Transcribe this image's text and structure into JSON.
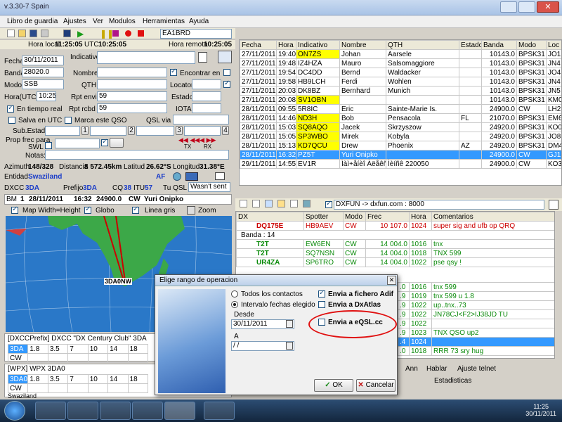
{
  "window": {
    "title": "v.3.30-7 Spain"
  },
  "menu": [
    "Libro de guardia",
    "Ajustes",
    "Ver",
    "Modulos",
    "Herramientas",
    "Ayuda"
  ],
  "toolbar": {
    "callsign": "EA1BRD"
  },
  "times": {
    "local_label": "Hora local",
    "local": "11:25:05",
    "utc_label": "UTC",
    "utc": "10:25:05",
    "remote_label": "Hora remota",
    "remote": "10:25:05"
  },
  "qso_form": {
    "fecha_label": "Fecha",
    "fecha": "30/11/2011",
    "indicativo_label": "Indicativo",
    "banda_label": "Banda",
    "banda": "28020.0",
    "nombre_label": "Nombre",
    "encontrar_label": "Encontrar en",
    "modo_label": "Modo",
    "modo": "SSB",
    "qth_label": "QTH",
    "locator_label": "Locator",
    "hora_label": "Hora(UTC)",
    "hora": "10:25",
    "rptenvi_label": "Rpt envi",
    "rptenvi": "59",
    "estado_label": "Estado",
    "en_tiempo_real": "En tiempo real",
    "rptrcbd_label": "Rpt rcbd",
    "rptrcbd": "59",
    "iota_label": "IOTA",
    "salva_utc": "Salva en UTC",
    "marca_qso": "Marca este QSO",
    "qsl_via_label": "QSL via",
    "subestado_label": "Sub.Estado:",
    "sub_btns": [
      "1",
      "2",
      "3",
      "4"
    ],
    "prop_label": "Prop frec para",
    "swl_label": "SWL",
    "notas_label": "Notas:",
    "tx_label": "TX",
    "rx_label": "RX"
  },
  "info": {
    "azimuth_label": "Azimuth",
    "azimuth": "148/328",
    "distancia_label": "Distancia",
    "distancia": "8 572.45km",
    "latitud_label": "Latitud",
    "latitud": "26.62°S",
    "longitud_label": "Longitud",
    "longitud": "31.38°E",
    "entidad_label": "Entidad",
    "entidad": "Swaziland",
    "continent": "AF",
    "dxcc_label": "DXCC",
    "dxcc": "3DA",
    "prefijo_label": "Prefijo",
    "prefijo": "3DA",
    "cq_label": "CQ",
    "cq": "38",
    "itu_label": "ITU",
    "itu": "57",
    "tuqsl_label": "Tu QSL",
    "tuqsl": "Wasn't sent"
  },
  "spot_bar": {
    "bm": "BM",
    "num": "1",
    "date": "28/11/2011",
    "time": "16:32",
    "freq": "24900.0",
    "mode": "CW",
    "name": "Yuri Onipko"
  },
  "map_bar": {
    "width_height": "Map Width=Height",
    "globo": "Globo",
    "linea_gris": "Linea gris",
    "zoom": "Zoom"
  },
  "map": {
    "marker": "3DA0NW"
  },
  "dxcc_table": {
    "title": "[DXCCPrefix] DXCC \"DX Century Club\" 3DA",
    "bands": [
      "3DA",
      "1.8",
      "3.5",
      "7",
      "10",
      "14",
      "18"
    ],
    "row2": "CW"
  },
  "wpx_table": {
    "title": "[WPX] WPX 3DA0",
    "bands": [
      "3DA0",
      "1.8",
      "3.5",
      "7",
      "10",
      "14",
      "18"
    ],
    "row2": "CW",
    "footer": "Swaziland"
  },
  "log_table": {
    "headers": [
      "Fecha",
      "Hora",
      "Indicativo",
      "Nombre",
      "QTH",
      "Estado",
      "Banda",
      "Modo",
      "Loc"
    ],
    "rows": [
      {
        "fecha": "27/11/2011",
        "hora": "19:40",
        "call": "ON7ZS",
        "yellow": true,
        "name": "Johan",
        "qth": "Aarsele",
        "estado": "",
        "banda": "10143.0",
        "modo": "BPSK31",
        "loc": "JO1"
      },
      {
        "fecha": "27/11/2011",
        "hora": "19:48",
        "call": "IZ4HZA",
        "yellow": false,
        "name": "Mauro",
        "qth": "Salsomaggiore",
        "estado": "",
        "banda": "10143.0",
        "modo": "BPSK31",
        "loc": "JN4"
      },
      {
        "fecha": "27/11/2011",
        "hora": "19:54",
        "call": "DC4DD",
        "yellow": false,
        "name": "Bernd",
        "qth": "Waldacker",
        "estado": "",
        "banda": "10143.0",
        "modo": "BPSK31",
        "loc": "JO4"
      },
      {
        "fecha": "27/11/2011",
        "hora": "19:58",
        "call": "HB9LCH",
        "yellow": false,
        "name": "Ferdi",
        "qth": "Wohlen",
        "estado": "",
        "banda": "10143.0",
        "modo": "BPSK31",
        "loc": "JN4"
      },
      {
        "fecha": "27/11/2011",
        "hora": "20:03",
        "call": "DK8BZ",
        "yellow": false,
        "name": "Bernhard",
        "qth": "Munich",
        "estado": "",
        "banda": "10143.0",
        "modo": "BPSK31",
        "loc": "JN5"
      },
      {
        "fecha": "27/11/2011",
        "hora": "20:08",
        "call": "SV1OBN",
        "yellow": true,
        "name": "",
        "qth": "",
        "estado": "",
        "banda": "10143.0",
        "modo": "BPSK31",
        "loc": "KM0"
      },
      {
        "fecha": "28/11/2011",
        "hora": "09:55",
        "call": "5R8IC",
        "yellow": false,
        "name": "Eric",
        "qth": "Sainte-Marie Is.",
        "estado": "",
        "banda": "24900.0",
        "modo": "CW",
        "loc": "LH2"
      },
      {
        "fecha": "28/11/2011",
        "hora": "14:46",
        "call": "ND3H",
        "yellow": true,
        "name": "Bob",
        "qth": "Pensacola",
        "estado": "FL",
        "banda": "21070.0",
        "modo": "BPSK31",
        "loc": "EM6"
      },
      {
        "fecha": "28/11/2011",
        "hora": "15:03",
        "call": "SQ8AQO",
        "yellow": true,
        "name": "Jacek",
        "qth": "Skrzyszow",
        "estado": "",
        "banda": "24920.0",
        "modo": "BPSK31",
        "loc": "KO0"
      },
      {
        "fecha": "28/11/2011",
        "hora": "15:05",
        "call": "SP3WBO",
        "yellow": true,
        "name": "Mirek",
        "qth": "Kobyla",
        "estado": "",
        "banda": "24920.0",
        "modo": "BPSK31",
        "loc": "JO8"
      },
      {
        "fecha": "28/11/2011",
        "hora": "15:13",
        "call": "KD7QCU",
        "yellow": true,
        "name": "Drew",
        "qth": "Phoenix",
        "estado": "AZ",
        "banda": "24920.0",
        "modo": "BPSK31",
        "loc": "DM4"
      },
      {
        "fecha": "28/11/2011",
        "hora": "16:32",
        "call": "PZ5T",
        "yellow": false,
        "name": "Yuri Onipko",
        "qth": "",
        "estado": "",
        "banda": "24900.0",
        "modo": "CW",
        "loc": "GJ1",
        "selected": true
      },
      {
        "fecha": "29/11/2011",
        "hora": "14:55",
        "call": "EV1R",
        "yellow": false,
        "name": "Ìàì+åíèî Àëåêñ",
        "qth": "Ìèíñê 220050",
        "estado": "",
        "banda": "24900.0",
        "modo": "CW",
        "loc": "KO3"
      }
    ]
  },
  "cluster": {
    "server": "DXFUN -> dxfun.com : 8000",
    "headers": [
      "DX",
      "Spotter",
      "Modo",
      "Frec",
      "Hora",
      "Comentarios"
    ],
    "first": {
      "dx": "DQ175E",
      "spotter": "HB9AEV",
      "modo": "CW",
      "frec": "10 107.0",
      "hora": "1024",
      "comment": "super sig and ufb op QRQ"
    },
    "band_label": "Banda : 14",
    "rows": [
      {
        "dx": "T2T",
        "spotter": "EW6EN",
        "modo": "CW",
        "frec": "14 004.0",
        "hora": "1016",
        "comment": "tnx"
      },
      {
        "dx": "T2T",
        "spotter": "SQ7NSN",
        "modo": "CW",
        "frec": "14 004.0",
        "hora": "1018",
        "comment": "TNX 599"
      },
      {
        "dx": "UR4ZA",
        "spotter": "SP6TRO",
        "modo": "CW",
        "frec": "14 004.0",
        "hora": "1022",
        "comment": "pse qsy !"
      }
    ],
    "partial": [
      {
        "frec": ".0",
        "hora": "1016",
        "comment": "tnx 599"
      },
      {
        "frec": ".9",
        "hora": "1019",
        "comment": "tnx 599 u 1.8"
      },
      {
        "frec": ".9",
        "hora": "1022",
        "comment": "up..tnx..73"
      },
      {
        "frec": ".9",
        "hora": "1022",
        "comment": "JN78CJ<F2>IJ38JD TU"
      },
      {
        "frec": ".9",
        "hora": "1022",
        "comment": ""
      },
      {
        "frec": ".9",
        "hora": "1023",
        "comment": "TNX QSO up2"
      },
      {
        "frec": ".4",
        "hora": "1024",
        "comment": ""
      },
      {
        "frec": ".0",
        "hora": "1018",
        "comment": "RRR 73 sry hug"
      }
    ],
    "tabs": [
      "Ann",
      "Hablar",
      "Ajuste telnet"
    ],
    "estadisticas": "Estadisticas"
  },
  "dialog": {
    "title": "Elige rango de operacion",
    "todos": "Todos los contactos",
    "intervalo": "Intervalo fechas elegido",
    "desde_label": "Desde",
    "desde": "30/11/2011",
    "a_label": "A",
    "a": " / /",
    "adif": "Envia a fichero Adif",
    "dxatlas": "Envia a DxAtlas",
    "eqsl": "Envia a eQSL.cc",
    "ok": "OK",
    "cancel": "Cancelar"
  },
  "taskbar": {
    "time": "11:25",
    "date": "30/11/2011"
  }
}
